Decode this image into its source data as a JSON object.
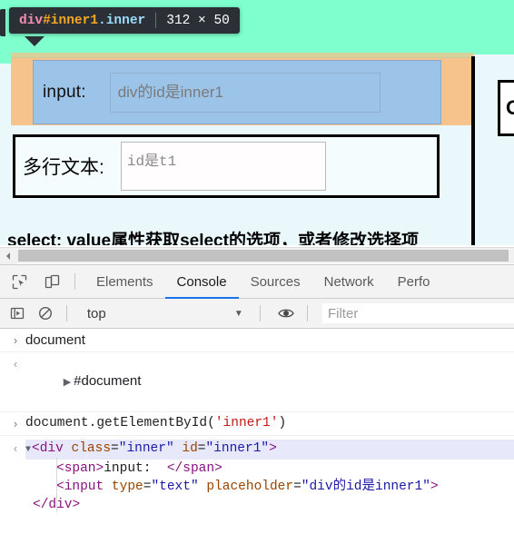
{
  "highlight_tooltip": {
    "tag": "div",
    "id": "#inner1",
    "class": ".inner",
    "dimensions": "312 × 50"
  },
  "page": {
    "row1": {
      "label": "input:",
      "input_placeholder": "div的id是inner1",
      "input_value": ""
    },
    "row2": {
      "label": "多行文本:",
      "textarea_placeholder": "id是t1",
      "textarea_value": ""
    },
    "right_box_text": "OI",
    "select_line": "select: value属性获取select的选项，或者修改选择项"
  },
  "devtools": {
    "tabs": [
      {
        "label": "Elements",
        "active": false
      },
      {
        "label": "Console",
        "active": true
      },
      {
        "label": "Sources",
        "active": false
      },
      {
        "label": "Network",
        "active": false
      },
      {
        "label": "Perfo",
        "active": false
      }
    ],
    "toolbar": {
      "inspect_icon": "inspect-element-icon",
      "device_icon": "device-toolbar-icon"
    },
    "console_toolbar": {
      "sidebar_icon": "console-sidebar-icon",
      "clear_icon": "clear-console-icon",
      "context_value": "top",
      "caret": "▼",
      "eye_icon": "live-expression-icon",
      "filter_placeholder": "Filter"
    },
    "console_log": [
      {
        "gutter": "›",
        "kind": "command",
        "text": "document"
      },
      {
        "gutter": "‹",
        "kind": "result-node",
        "disclosure": "▶",
        "text": "#document"
      },
      {
        "gutter": "›",
        "kind": "command-string",
        "prefix": "document.getElementById(",
        "string": "'inner1'",
        "suffix": ")"
      }
    ],
    "node_output": {
      "gutter": "‹",
      "disclosure": "▼",
      "lines": [
        {
          "indent": 0,
          "highlighted": true,
          "parts": [
            {
              "t": "punc",
              "s": "<"
            },
            {
              "t": "tag",
              "s": "div"
            },
            {
              "t": "txt",
              "s": " "
            },
            {
              "t": "attr",
              "s": "class"
            },
            {
              "t": "txt",
              "s": "="
            },
            {
              "t": "val",
              "s": "\"inner\""
            },
            {
              "t": "txt",
              "s": " "
            },
            {
              "t": "attr",
              "s": "id"
            },
            {
              "t": "txt",
              "s": "="
            },
            {
              "t": "val",
              "s": "\"inner1\""
            },
            {
              "t": "punc",
              "s": ">"
            }
          ]
        },
        {
          "indent": 1,
          "highlighted": false,
          "parts": [
            {
              "t": "punc",
              "s": "<"
            },
            {
              "t": "tag",
              "s": "span"
            },
            {
              "t": "punc",
              "s": ">"
            },
            {
              "t": "txt",
              "s": "input:  "
            },
            {
              "t": "punc",
              "s": "</"
            },
            {
              "t": "tag",
              "s": "span"
            },
            {
              "t": "punc",
              "s": ">"
            }
          ]
        },
        {
          "indent": 1,
          "highlighted": false,
          "parts": [
            {
              "t": "punc",
              "s": "<"
            },
            {
              "t": "tag",
              "s": "input"
            },
            {
              "t": "txt",
              "s": " "
            },
            {
              "t": "attr",
              "s": "type"
            },
            {
              "t": "txt",
              "s": "="
            },
            {
              "t": "val",
              "s": "\"text\""
            },
            {
              "t": "txt",
              "s": " "
            },
            {
              "t": "attr",
              "s": "placeholder"
            },
            {
              "t": "txt",
              "s": "="
            },
            {
              "t": "val",
              "s": "\"div的id是inner1\""
            },
            {
              "t": "punc",
              "s": ">"
            }
          ]
        },
        {
          "indent": 0,
          "highlighted": false,
          "parts": [
            {
              "t": "punc",
              "s": "</"
            },
            {
              "t": "tag",
              "s": "div"
            },
            {
              "t": "punc",
              "s": ">"
            }
          ]
        }
      ]
    }
  },
  "scrollbar": {
    "left_arrow": "scroll-left-arrow-icon"
  },
  "colors": {
    "margin_overlay": "#7effcd",
    "padding_overlay": "#f7c38c",
    "content_overlay": "#9cc3e8",
    "border_overlay": "#d8d09a",
    "tab_accent": "#1a73e8",
    "tooltip_bg": "#2b2f36"
  }
}
